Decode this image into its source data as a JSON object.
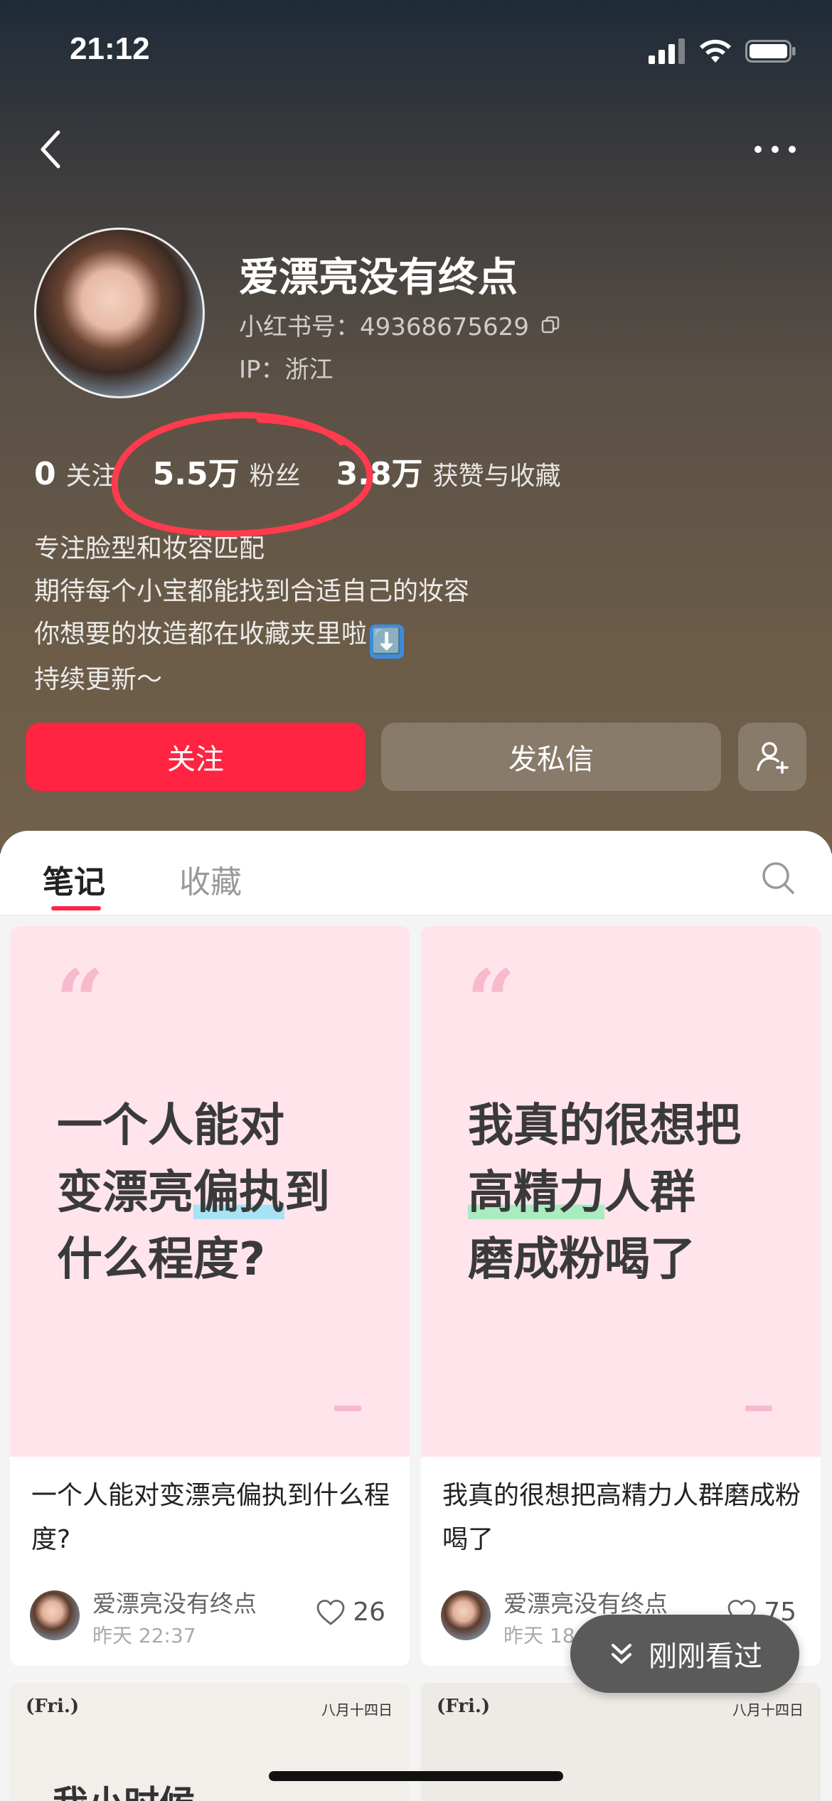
{
  "status_bar": {
    "time": "21:12"
  },
  "profile": {
    "name": "爱漂亮没有终点",
    "xhs_id": "小红书号：49368675629",
    "ip": "IP：浙江"
  },
  "stats": [
    {
      "num": "0",
      "label": "关注"
    },
    {
      "num": "5.5万",
      "label": "粉丝"
    },
    {
      "num": "3.8万",
      "label": "获赞与收藏"
    }
  ],
  "bio": [
    "专注脸型和妆容匹配",
    "期待每个小宝都能找到合适自己的妆容",
    "你想要的妆造都在收藏夹里啦",
    "持续更新～"
  ],
  "bio_emoji": "⬇️",
  "buttons": {
    "follow": "关注",
    "message": "发私信"
  },
  "tabs": {
    "notes": "笔记",
    "favorites": "收藏"
  },
  "notes": [
    {
      "cover_lines": [
        "一个人能对",
        "变漂亮",
        "偏执",
        "到",
        "什么程度?"
      ],
      "title": "一个人能对变漂亮偏执到什么程度?",
      "author": "爱漂亮没有终点",
      "time": "昨天 22:37",
      "likes": "26"
    },
    {
      "cover_lines": [
        "我真的很想把",
        "高精力",
        "人群",
        "磨成粉喝了"
      ],
      "title": "我真的很想把高精力人群磨成粉喝了",
      "author": "爱漂亮没有终点",
      "time": "昨天 18",
      "likes": "75"
    }
  ],
  "peek_cards": [
    {
      "fri": "(Fri.)",
      "date": "八月十四日",
      "text": "我小时候"
    },
    {
      "fri": "(Fri.)",
      "date": "八月十四日"
    }
  ],
  "recent_button": "刚刚看过",
  "colors": {
    "brand_red": "#ff2442",
    "cover_pink": "#ffe4ec"
  }
}
